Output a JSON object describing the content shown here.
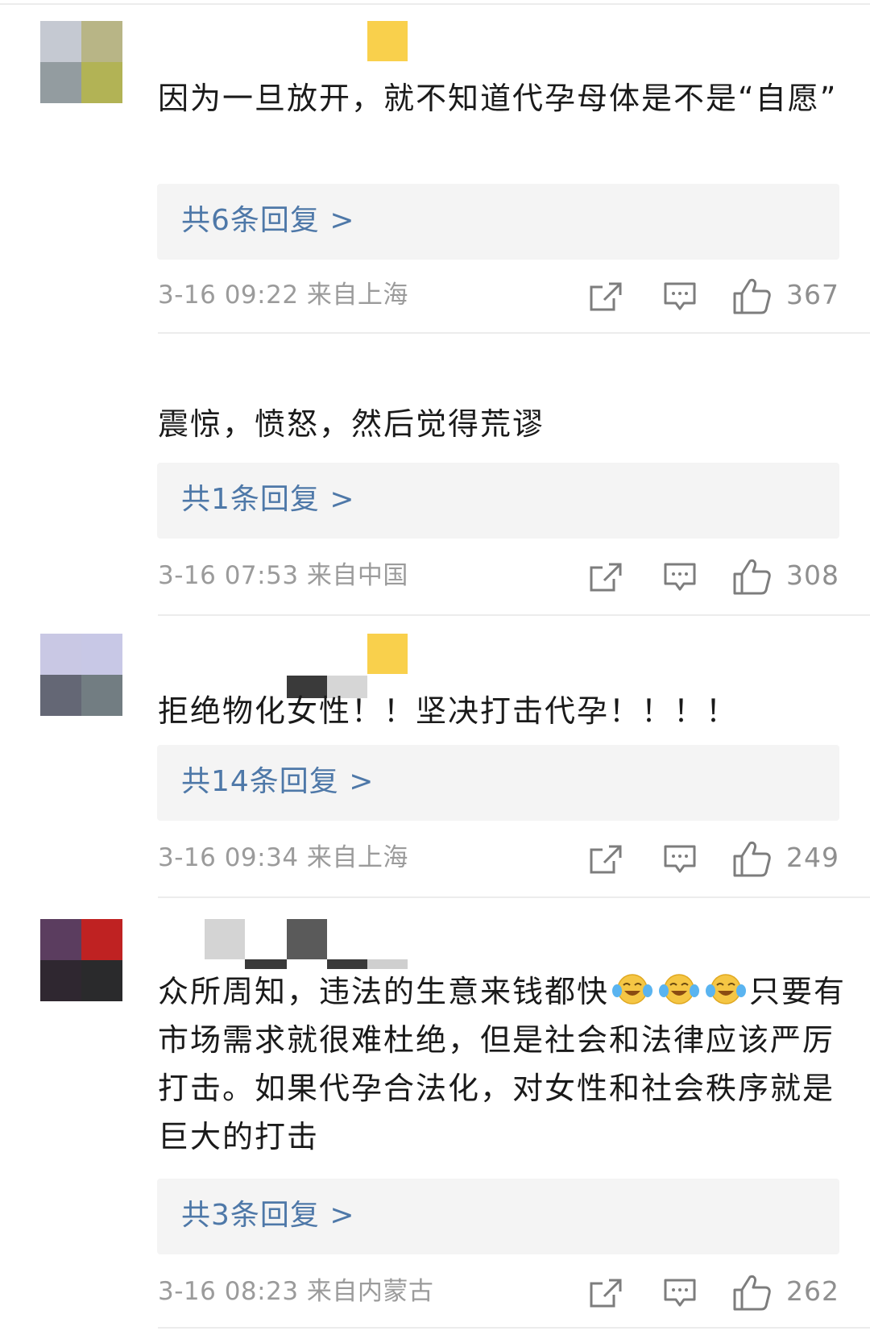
{
  "comments": [
    {
      "text": "因为一旦放开，就不知道代孕母体是不是“自愿”",
      "replies": "共6条回复 >",
      "time_location": "3-16 09:22 来自上海",
      "likes": "367"
    },
    {
      "text": "震惊，愤怒，然后觉得荒谬",
      "replies": "共1条回复 >",
      "time_location": "3-16 07:53 来自中国",
      "likes": "308"
    },
    {
      "text": "拒绝物化女性！！坚决打击代孕！！！！",
      "replies": "共14条回复 >",
      "time_location": "3-16 09:34 来自上海",
      "likes": "249"
    },
    {
      "text_before_emoji": "众所周知，违法的生意来钱都快",
      "emojis": [
        "laughing-crying-emoji",
        "laughing-crying-emoji",
        "laughing-crying-emoji"
      ],
      "text_after_emoji": "只要有市场需求就很难杜绝，但是社会和法律应该严厉打击。如果代孕合法化，对女性和社会秩序就是巨大的打击",
      "replies": "共3条回复 >",
      "time_location": "3-16 08:23 来自内蒙古",
      "likes": "262"
    }
  ],
  "icons": {
    "share": "share-icon",
    "comment": "comment-icon",
    "like": "thumbs-up-icon"
  },
  "colors": {
    "reply_link": "#4e78a8",
    "meta_text": "#9b9b9b",
    "reply_background": "#f4f4f4"
  }
}
